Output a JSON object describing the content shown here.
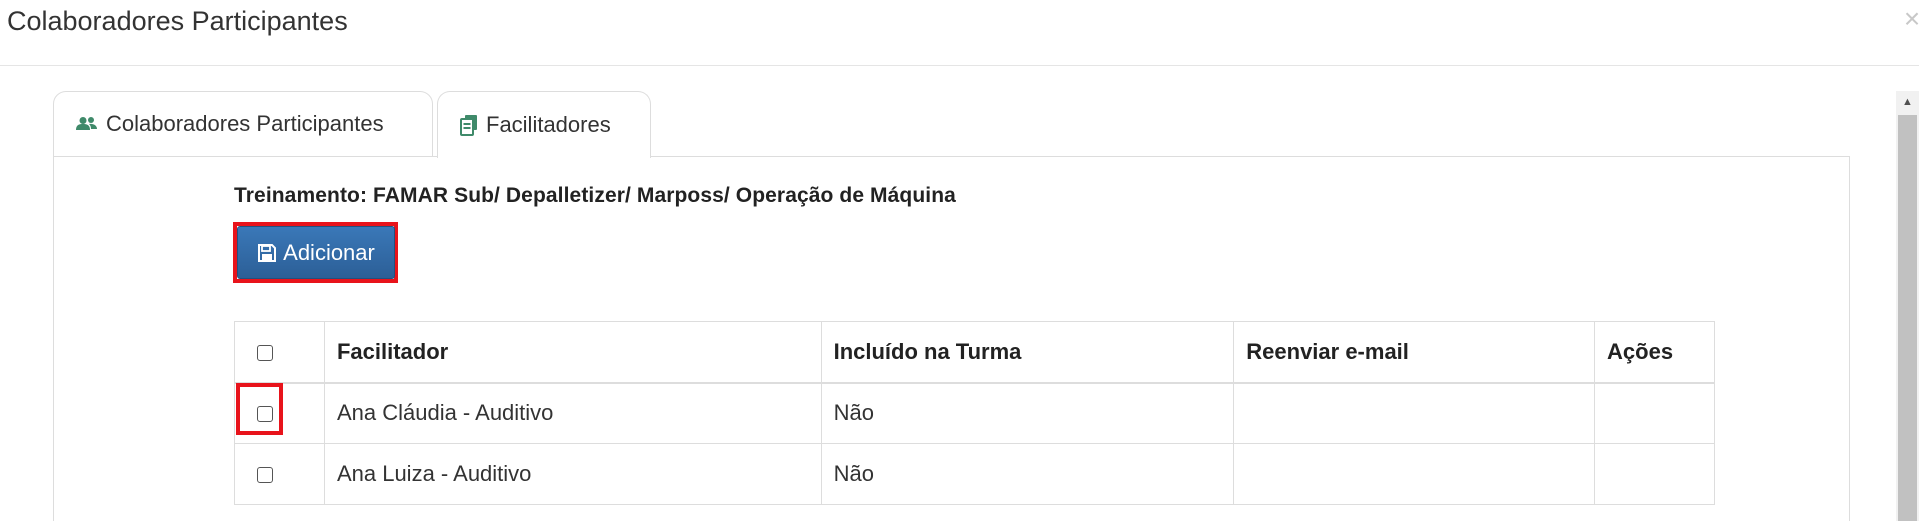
{
  "modal": {
    "title": "Colaboradores Participantes",
    "close_symbol": "×"
  },
  "tabs": [
    {
      "label": "Colaboradores Participantes",
      "icon": "users-icon",
      "active": false
    },
    {
      "label": "Facilitadores",
      "icon": "copy-files-icon",
      "active": true
    }
  ],
  "training_title": "Treinamento: FAMAR Sub/ Depalletizer/ Marposs/ Operação de Máquina",
  "add_button": {
    "label": "Adicionar",
    "icon": "save-icon"
  },
  "table": {
    "headers": [
      "Facilitador",
      "Incluído na Turma",
      "Reenviar e-mail",
      "Ações"
    ],
    "rows": [
      {
        "facilitador": "Ana Cláudia - Auditivo",
        "incluido": "Não",
        "reenviar": "",
        "acoes": ""
      },
      {
        "facilitador": "Ana Luiza - Auditivo",
        "incluido": "Não",
        "reenviar": "",
        "acoes": ""
      }
    ]
  },
  "colors": {
    "primary_button": "#2c5f97",
    "highlight": "#e8131b",
    "tab_icon": "#3f8a6a"
  }
}
